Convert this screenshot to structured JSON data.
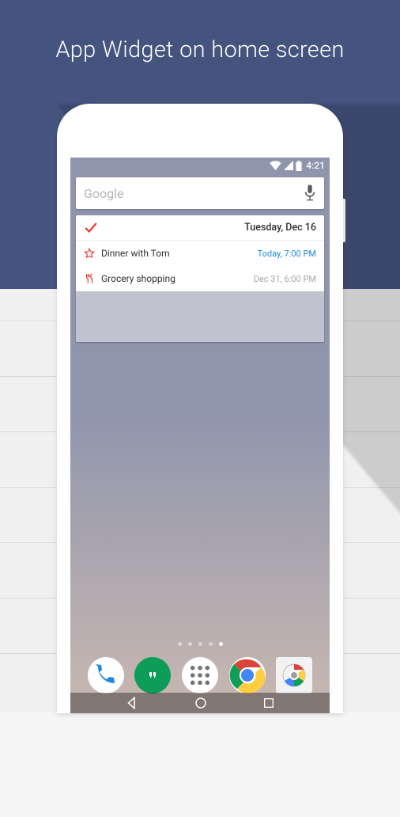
{
  "headline": "App Widget on home screen",
  "statusbar": {
    "time": "4:21"
  },
  "search": {
    "label": "Google"
  },
  "widget": {
    "date": "Tuesday, Dec 16",
    "items": [
      {
        "title": "Dinner with Tom",
        "when": "Today, 7:00 PM",
        "when_class": "blue",
        "icon": "star"
      },
      {
        "title": "Grocery shopping",
        "when": "Dec 31, 6:00 PM",
        "when_class": "grey",
        "icon": "fork"
      }
    ]
  }
}
